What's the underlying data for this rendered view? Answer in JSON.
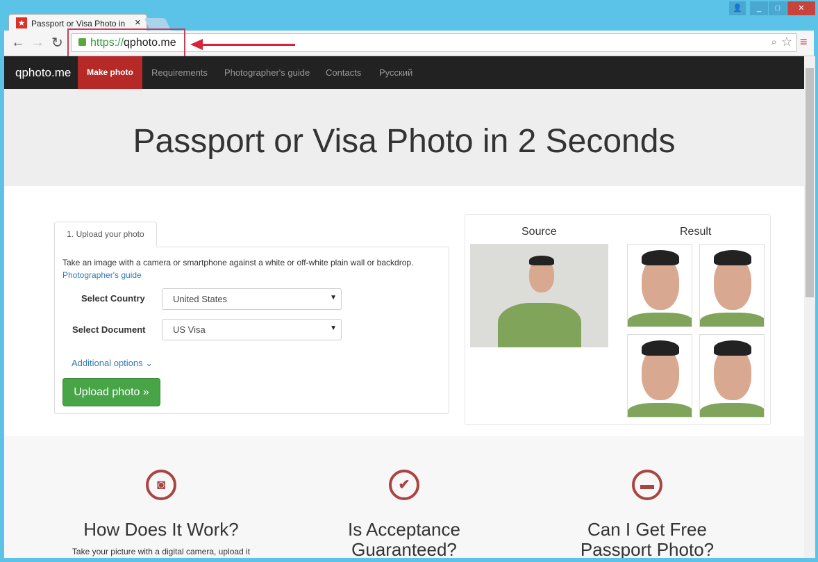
{
  "browser": {
    "tab_title": "Passport or Visa Photo in",
    "url_scheme": "https://",
    "url_host": "qphoto.me"
  },
  "nav": {
    "brand": "qphoto.me",
    "items": [
      "Make photo",
      "Requirements",
      "Photographer's guide",
      "Contacts",
      "Русский"
    ],
    "active_color": "#b52a27"
  },
  "hero": {
    "title": "Passport or Visa Photo in 2 Seconds"
  },
  "upload": {
    "tab": "1. Upload your photo",
    "instructions": "Take an image with a camera or smartphone against a white or off-white plain wall or backdrop.",
    "guide_link": "Photographer's guide",
    "country_label": "Select Country",
    "country_value": "United States",
    "document_label": "Select Document",
    "document_value": "US Visa",
    "additional": "Additional options",
    "button": "Upload photo »"
  },
  "preview": {
    "source": "Source",
    "result": "Result"
  },
  "features": [
    {
      "icon": "camera-icon",
      "title": "How Does It Work?",
      "text": "Take your picture with a digital camera, upload it to"
    },
    {
      "icon": "check-circle-icon",
      "title": "Is Acceptance Guaranteed?"
    },
    {
      "icon": "credit-card-icon",
      "title": "Can I Get Free Passport Photo?"
    }
  ]
}
